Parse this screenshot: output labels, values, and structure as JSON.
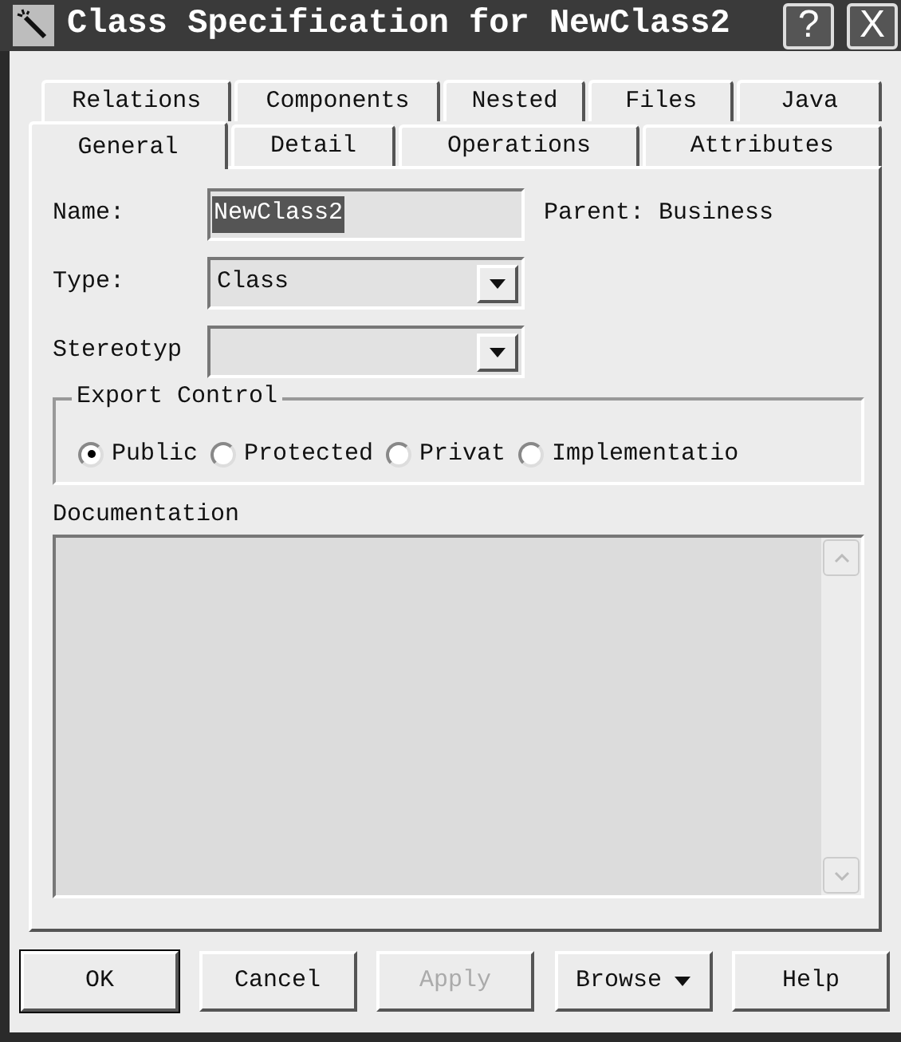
{
  "window": {
    "title": "Class Specification for NewClass2",
    "buttons": [
      "?",
      "X"
    ]
  },
  "tab_rows": [
    [
      {
        "label": "Relations",
        "selected": false
      },
      {
        "label": "Components",
        "selected": false
      },
      {
        "label": "Nested",
        "selected": false
      },
      {
        "label": "Files",
        "selected": false
      },
      {
        "label": "Java",
        "selected": false
      }
    ],
    [
      {
        "label": "General",
        "selected": true
      },
      {
        "label": "Detail",
        "selected": false
      },
      {
        "label": "Operations",
        "selected": false
      },
      {
        "label": "Attributes",
        "selected": false
      }
    ]
  ],
  "name": {
    "label": "Name:",
    "value": "NewClass2",
    "highlighted": true
  },
  "parent": "Parent: Business",
  "type": {
    "label": "Type:",
    "value": "Class"
  },
  "stereotype": {
    "label": "Stereotyp"
  },
  "export_control": {
    "label": "Export Control",
    "options": [
      {
        "label": "Public",
        "selected": true
      },
      {
        "label": "Protected",
        "selected": false
      },
      {
        "label": "Privat",
        "selected": false
      },
      {
        "label": "Implementatio",
        "selected": false
      }
    ]
  },
  "documentation": {
    "label": "Documentation"
  },
  "buttons": [
    {
      "label": "OK",
      "kind": "push",
      "default": true,
      "disabled": false
    },
    {
      "label": "Cancel",
      "kind": "push",
      "default": false,
      "disabled": false
    },
    {
      "label": "Apply",
      "kind": "push",
      "default": false,
      "disabled": true
    },
    {
      "label": "Browse",
      "kind": "menu",
      "default": false,
      "disabled": false
    },
    {
      "label": "Help",
      "kind": "push",
      "default": false,
      "disabled": false
    }
  ]
}
